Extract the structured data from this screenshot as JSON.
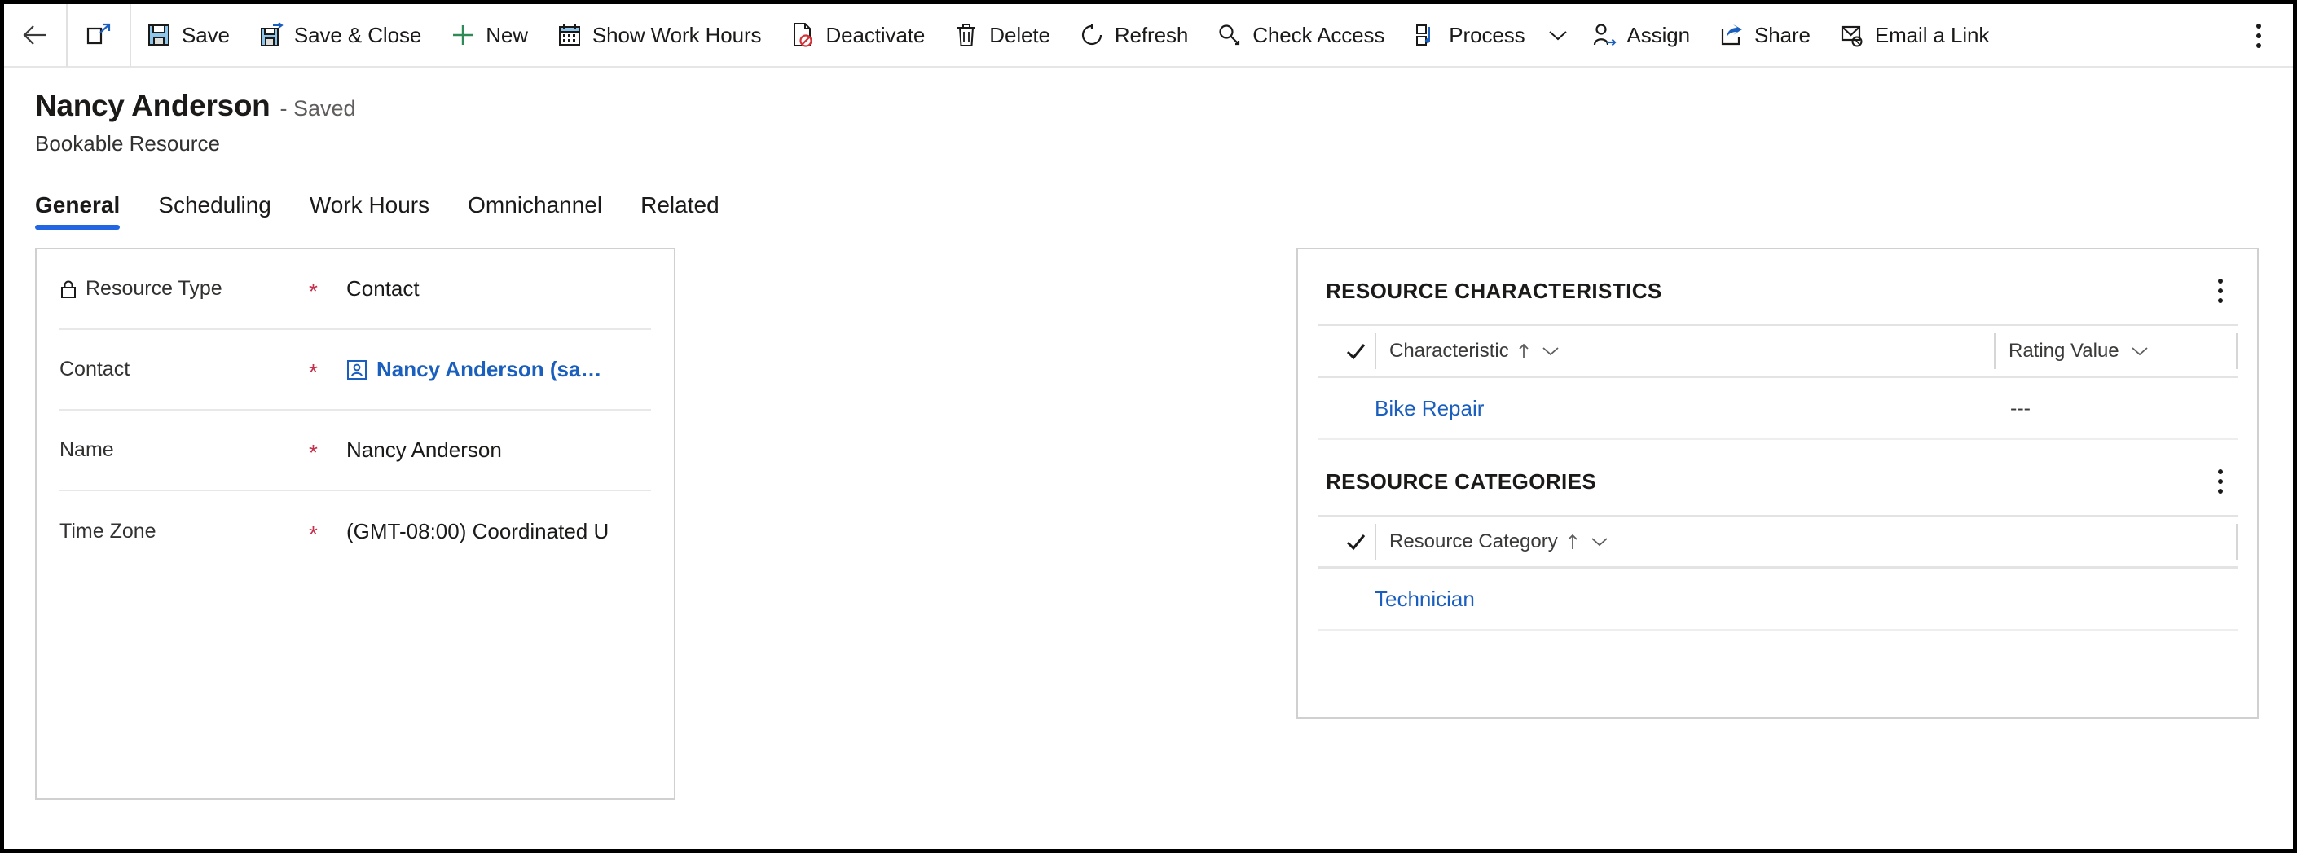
{
  "commandbar": {
    "back_tooltip": "Back",
    "popout_tooltip": "Open in new window",
    "items": [
      {
        "label": "Save",
        "icon": "save-icon"
      },
      {
        "label": "Save & Close",
        "icon": "save-and-close-icon"
      },
      {
        "label": "New",
        "icon": "plus-icon"
      },
      {
        "label": "Show Work Hours",
        "icon": "calendar-icon"
      },
      {
        "label": "Deactivate",
        "icon": "deactivate-icon"
      },
      {
        "label": "Delete",
        "icon": "trash-icon"
      },
      {
        "label": "Refresh",
        "icon": "refresh-icon"
      },
      {
        "label": "Check Access",
        "icon": "key-icon"
      },
      {
        "label": "Process",
        "icon": "process-icon",
        "has_caret": true
      },
      {
        "label": "Assign",
        "icon": "assign-person-icon"
      },
      {
        "label": "Share",
        "icon": "share-icon"
      },
      {
        "label": "Email a Link",
        "icon": "email-link-icon"
      }
    ],
    "overflow_label": "More commands"
  },
  "header": {
    "title": "Nancy Anderson",
    "status": "- Saved",
    "subtitle": "Bookable Resource"
  },
  "tabs": [
    {
      "label": "General",
      "active": true
    },
    {
      "label": "Scheduling",
      "active": false
    },
    {
      "label": "Work Hours",
      "active": false
    },
    {
      "label": "Omnichannel",
      "active": false
    },
    {
      "label": "Related",
      "active": false
    }
  ],
  "form": {
    "fields": [
      {
        "label": "Resource Type",
        "locked": true,
        "required": "*",
        "value": "Contact",
        "is_link": false
      },
      {
        "label": "Contact",
        "locked": false,
        "required": "*",
        "value": "Nancy Anderson (sa…",
        "is_link": true
      },
      {
        "label": "Name",
        "locked": false,
        "required": "*",
        "value": "Nancy Anderson",
        "is_link": false
      },
      {
        "label": "Time Zone",
        "locked": false,
        "required": "*",
        "value": "(GMT-08:00) Coordinated U",
        "is_link": false
      }
    ]
  },
  "side_panel": {
    "characteristics": {
      "title": "RESOURCE CHARACTERISTICS",
      "columns": [
        {
          "name": "Characteristic",
          "sorted": true
        },
        {
          "name": "Rating Value",
          "sorted": false
        }
      ],
      "rows": [
        {
          "characteristic": "Bike Repair",
          "rating_value": "---"
        }
      ]
    },
    "categories": {
      "title": "RESOURCE CATEGORIES",
      "columns": [
        {
          "name": "Resource Category",
          "sorted": true
        }
      ],
      "rows": [
        {
          "resource_category": "Technician"
        }
      ]
    }
  },
  "colors": {
    "accent": "#2266e3",
    "link": "#1b5fbe",
    "required": "#c4314b",
    "border": "#d0d0d0"
  }
}
